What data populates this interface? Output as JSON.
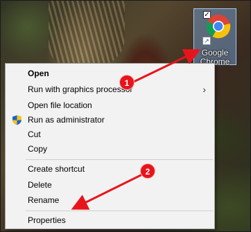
{
  "desktop_icon": {
    "label_line1": "Google",
    "label_line2": "Chrome",
    "checkbox": "✓",
    "icon": "chrome-icon",
    "overlay_icon": "shortcut-arrow-icon"
  },
  "context_menu": {
    "items": [
      {
        "label": "Open",
        "bold": true
      },
      {
        "label": "Run with graphics processor",
        "submenu": true
      },
      {
        "label": "Open file location"
      },
      {
        "label": "Run as administrator",
        "icon": "uac-shield-icon"
      },
      {
        "label": "Cut"
      },
      {
        "label": "Copy"
      },
      {
        "label": "Create shortcut"
      },
      {
        "label": "Delete"
      },
      {
        "label": "Rename"
      },
      {
        "label": "Properties"
      }
    ],
    "chevron": "›"
  },
  "annotations": {
    "badge1": "1",
    "badge2": "2",
    "color": "#e8141c"
  }
}
